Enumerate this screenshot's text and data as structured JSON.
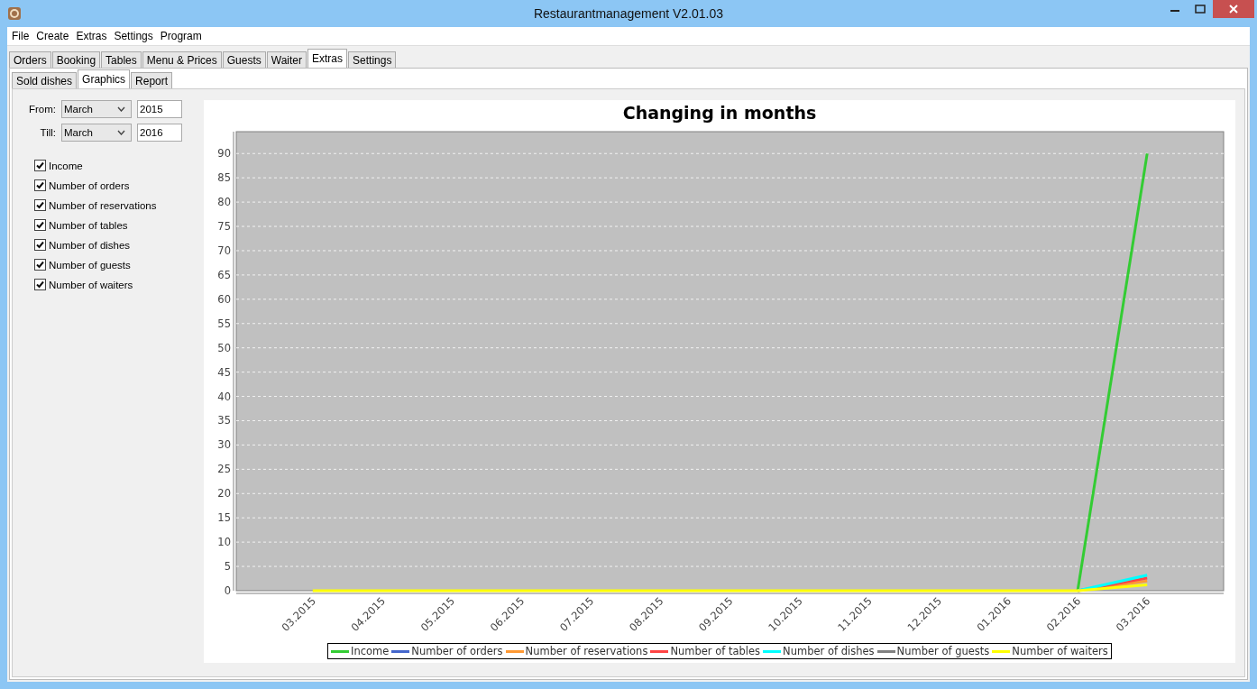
{
  "window": {
    "title": "Restaurantmanagement V2.01.03"
  },
  "menu": [
    "File",
    "Create",
    "Extras",
    "Settings",
    "Program"
  ],
  "tabs": [
    {
      "label": "Orders",
      "selected": false
    },
    {
      "label": "Booking",
      "selected": false
    },
    {
      "label": "Tables",
      "selected": false
    },
    {
      "label": "Menu & Prices",
      "selected": false
    },
    {
      "label": "Guests",
      "selected": false
    },
    {
      "label": "Waiter",
      "selected": false
    },
    {
      "label": "Extras",
      "selected": true
    },
    {
      "label": "Settings",
      "selected": false
    }
  ],
  "subtabs": [
    {
      "label": "Sold dishes",
      "selected": false
    },
    {
      "label": "Graphics",
      "selected": true
    },
    {
      "label": "Report",
      "selected": false
    }
  ],
  "range": [
    {
      "label": "From:",
      "month": "March",
      "year": "2015"
    },
    {
      "label": "Till:",
      "month": "March",
      "year": "2016"
    }
  ],
  "options": [
    {
      "label": "Income",
      "checked": true
    },
    {
      "label": "Number of orders",
      "checked": true
    },
    {
      "label": "Number of reservations",
      "checked": true
    },
    {
      "label": "Number of tables",
      "checked": true
    },
    {
      "label": "Number of dishes",
      "checked": true
    },
    {
      "label": "Number of guests",
      "checked": true
    },
    {
      "label": "Number of waiters",
      "checked": true
    }
  ],
  "chart": {
    "chart_data": {
      "type": "line",
      "title": "Changing in months",
      "categories": [
        "03.2015",
        "04.2015",
        "05.2015",
        "06.2015",
        "07.2015",
        "08.2015",
        "09.2015",
        "10.2015",
        "11.2015",
        "12.2015",
        "01.2016",
        "02.2016",
        "03.2016"
      ],
      "ylim": [
        0,
        94.5
      ],
      "grid": true,
      "legend": "bottom",
      "yticks": [
        0,
        5,
        10,
        15,
        20,
        25,
        30,
        35,
        40,
        45,
        50,
        55,
        60,
        65,
        70,
        75,
        80,
        85,
        90
      ],
      "series": [
        {
          "name": "Income",
          "color": "#33cc33",
          "values": [
            null,
            null,
            null,
            null,
            null,
            null,
            null,
            null,
            null,
            null,
            null,
            0,
            90
          ]
        },
        {
          "name": "Number of orders",
          "color": "#4466cc",
          "values": [
            null,
            null,
            null,
            null,
            null,
            null,
            null,
            null,
            null,
            null,
            null,
            null,
            null
          ]
        },
        {
          "name": "Number of reservations",
          "color": "#ff9933",
          "values": [
            null,
            null,
            null,
            null,
            null,
            null,
            null,
            null,
            null,
            null,
            null,
            0,
            2
          ]
        },
        {
          "name": "Number of tables",
          "color": "#ff4444",
          "values": [
            null,
            null,
            null,
            null,
            null,
            null,
            null,
            null,
            null,
            null,
            null,
            0,
            2.6
          ]
        },
        {
          "name": "Number of dishes",
          "color": "#00ffff",
          "values": [
            null,
            null,
            null,
            null,
            null,
            null,
            null,
            null,
            null,
            null,
            null,
            0,
            3.2
          ]
        },
        {
          "name": "Number of guests",
          "color": "#808080",
          "values": [
            null,
            null,
            null,
            null,
            null,
            null,
            null,
            null,
            null,
            null,
            null,
            null,
            null
          ]
        },
        {
          "name": "Number of waiters",
          "color": "#ffff00",
          "values": [
            0,
            0,
            0,
            0,
            0,
            0,
            0,
            0,
            0,
            0,
            0,
            0,
            1.2
          ]
        }
      ]
    }
  }
}
